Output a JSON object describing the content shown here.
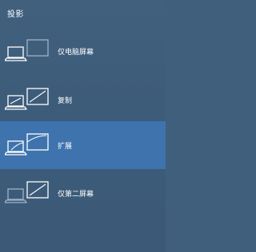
{
  "panel": {
    "title": "投影"
  },
  "options": [
    {
      "label": "仅电脑屏幕",
      "icon": "pc-screen-only-icon",
      "selected": false
    },
    {
      "label": "复制",
      "icon": "duplicate-icon",
      "selected": false
    },
    {
      "label": "扩展",
      "icon": "extend-icon",
      "selected": true
    },
    {
      "label": "仅第二屏幕",
      "icon": "second-screen-only-icon",
      "selected": false
    }
  ],
  "colors": {
    "background": "#3f5f7d",
    "selected": "#3e73ad",
    "text": "#ffffff",
    "dim": "#8fa6bc"
  }
}
